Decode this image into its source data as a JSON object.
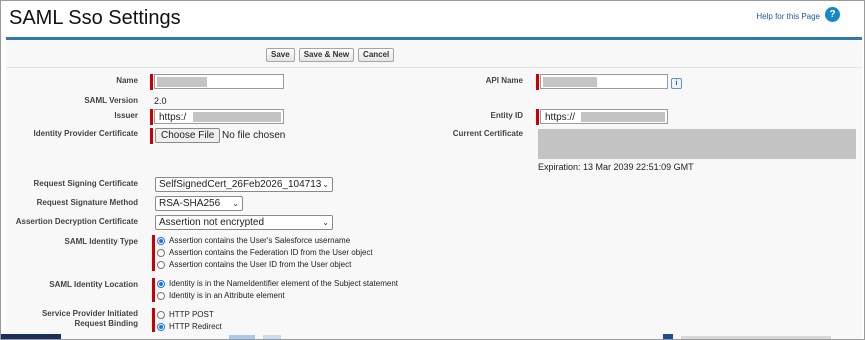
{
  "header": {
    "title": "SAML Sso Settings",
    "help_link": "Help for this Page",
    "help_icon": "help-icon"
  },
  "toolbar": {
    "save": "Save",
    "save_new": "Save & New",
    "cancel": "Cancel"
  },
  "left": {
    "name": {
      "label": "Name",
      "value": ""
    },
    "saml_version": {
      "label": "SAML Version",
      "value": "2.0"
    },
    "issuer": {
      "label": "Issuer",
      "value": "https:/"
    },
    "idp_cert": {
      "label": "Identity Provider Certificate",
      "button": "Choose File",
      "status": "No file chosen"
    },
    "req_sign_cert": {
      "label": "Request Signing Certificate",
      "value": "SelfSignedCert_26Feb2026_104713"
    },
    "req_sign_method": {
      "label": "Request Signature Method",
      "value": "RSA-SHA256"
    },
    "assert_decrypt": {
      "label": "Assertion Decryption Certificate",
      "value": "Assertion not encrypted"
    },
    "identity_type": {
      "label": "SAML Identity Type",
      "options": [
        "Assertion contains the User's Salesforce username",
        "Assertion contains the Federation ID from the User object",
        "Assertion contains the User ID from the User object"
      ],
      "selected": 0
    },
    "identity_location": {
      "label": "SAML Identity Location",
      "options": [
        "Identity is in the NameIdentifier element of the Subject statement",
        "Identity is in an Attribute element"
      ],
      "selected": 0
    },
    "sp_binding": {
      "label_line1": "Service Provider Initiated",
      "label_line2": "Request Binding",
      "options": [
        "HTTP POST",
        "HTTP Redirect"
      ],
      "selected": 1
    }
  },
  "right": {
    "api_name": {
      "label": "API Name",
      "value": "",
      "info_icon": "i"
    },
    "entity_id": {
      "label": "Entity ID",
      "value": "https://"
    },
    "current_cert": {
      "label": "Current Certificate",
      "expiration": "Expiration: 13 Mar 2039 22:51:09 GMT"
    }
  },
  "colors": {
    "accent": "#2e7aa8",
    "required": "#cc0000",
    "link": "#1a5aa6"
  }
}
